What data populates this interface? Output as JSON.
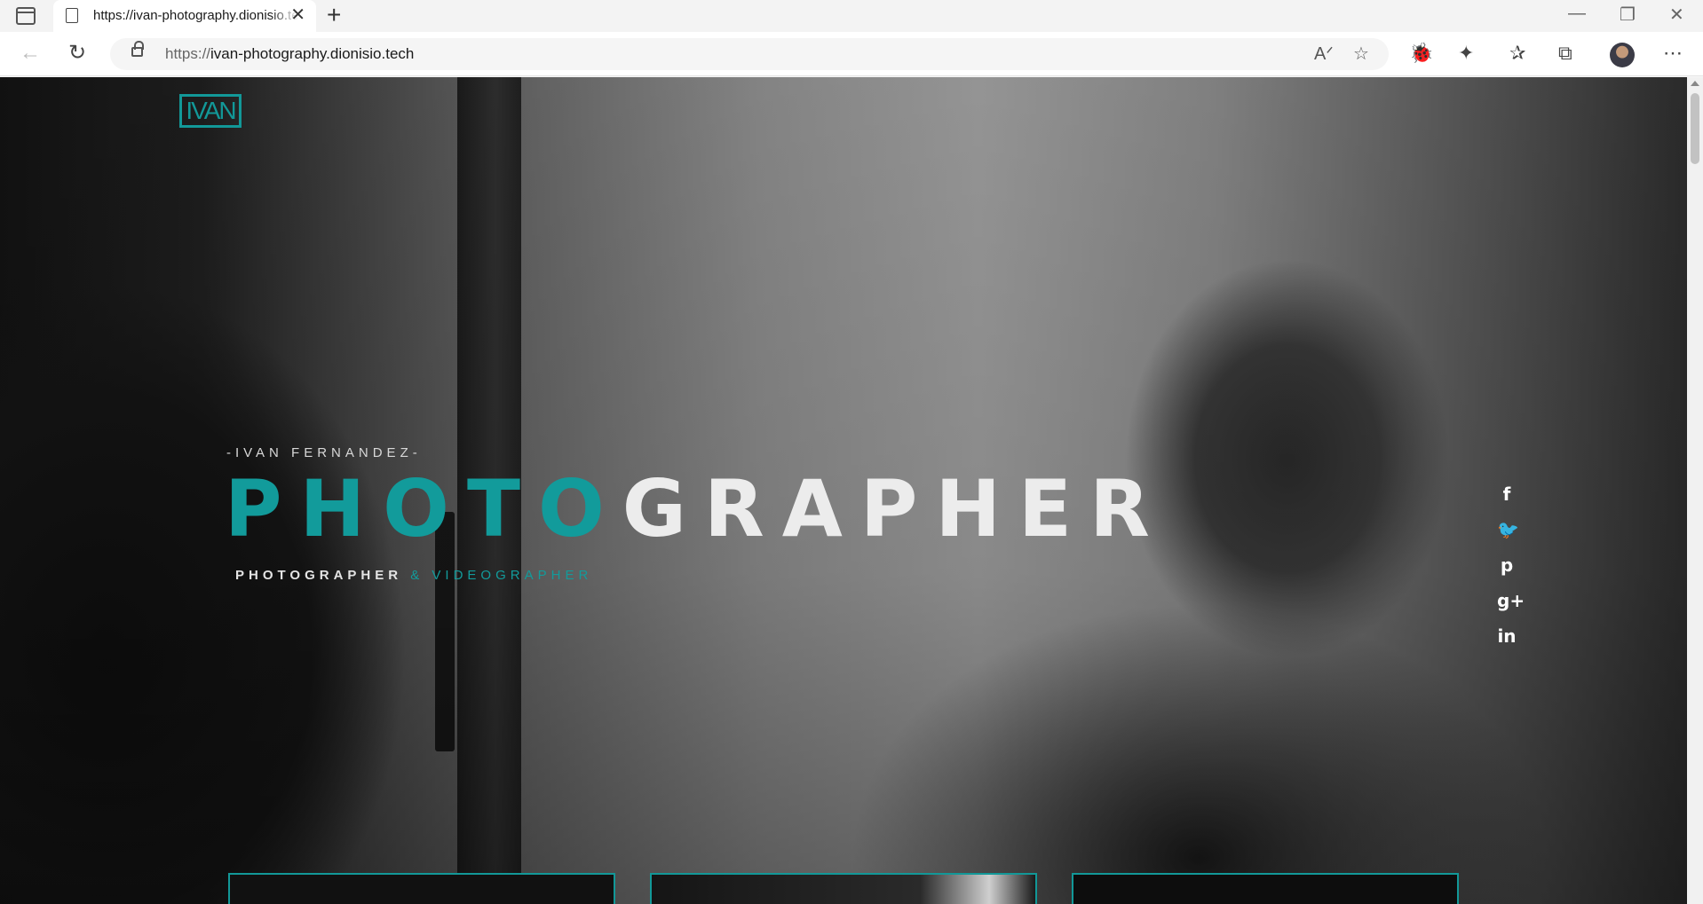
{
  "browser": {
    "tab_title": "https://ivan-photography.dionisio.tech",
    "url_scheme": "https://",
    "url_host": "ivan-photography.dionisio.tech",
    "icons": [
      "sidebar-icon",
      "page-icon",
      "close-icon",
      "new-tab-icon",
      "minimize-icon",
      "restore-icon",
      "window-close-icon",
      "back-icon",
      "refresh-icon",
      "lock-icon",
      "read-aloud-icon",
      "favorite-add-icon",
      "extension-icon",
      "puzzle-icon",
      "favorites-icon",
      "collections-icon",
      "profile-avatar",
      "more-icon"
    ]
  },
  "page": {
    "logo_text": "IVAN",
    "accent_color": "#129b9b",
    "eyebrow": "-IVAN FERNANDEZ-",
    "title_accent": "PHOTO",
    "title_rest": "GRAPHER",
    "tagline_plain": "PHOTOGRAPHER",
    "tagline_accent": " & VIDEOGRAPHER",
    "social": [
      {
        "name": "facebook",
        "glyph": "f"
      },
      {
        "name": "twitter",
        "glyph": "🐦"
      },
      {
        "name": "pinterest",
        "glyph": "p"
      },
      {
        "name": "google-plus",
        "glyph": "g+"
      },
      {
        "name": "linkedin",
        "glyph": "in"
      }
    ]
  }
}
